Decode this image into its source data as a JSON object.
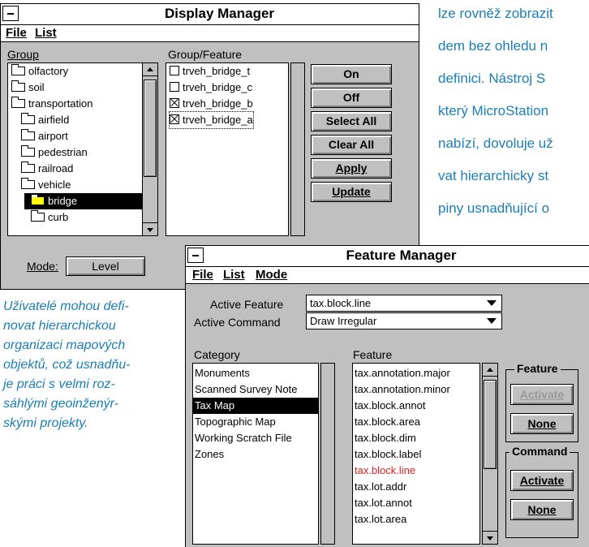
{
  "article": {
    "lines": [
      "lze rovněž zobrazit",
      "dem bez ohledu n",
      "definici. Nástroj S",
      "který MicroStation",
      "nabízí, dovoluje už",
      "vat hierarchicky st",
      "piny usnadňující o"
    ],
    "caption": [
      "Uživatelé mohou defi-",
      "novat hierarchickou",
      "organizaci mapových",
      "objektů, což usnadňu-",
      "je práci s velmi roz-",
      "sáhlými geoinženýr-",
      "skými projekty."
    ]
  },
  "display_manager": {
    "title": "Display Manager",
    "menu": [
      "File",
      "List"
    ],
    "group_label": "Group",
    "feature_label": "Group/Feature",
    "groups": [
      {
        "label": "olfactory",
        "indent": 0
      },
      {
        "label": "soil",
        "indent": 0
      },
      {
        "label": "transportation",
        "indent": 0
      },
      {
        "label": "airfield",
        "indent": 1
      },
      {
        "label": "airport",
        "indent": 1
      },
      {
        "label": "pedestrian",
        "indent": 1
      },
      {
        "label": "railroad",
        "indent": 1
      },
      {
        "label": "vehicle",
        "indent": 1
      },
      {
        "label": "bridge",
        "indent": 2,
        "selected": true
      },
      {
        "label": "curb",
        "indent": 2
      }
    ],
    "features": [
      {
        "label": "trveh_bridge_t",
        "checked": false
      },
      {
        "label": "trveh_bridge_c",
        "checked": false
      },
      {
        "label": "trveh_bridge_b",
        "checked": true
      },
      {
        "label": "trveh_bridge_a",
        "checked": true
      }
    ],
    "buttons": [
      "On",
      "Off",
      "Select All",
      "Clear All",
      "Apply",
      "Update"
    ],
    "mode_label": "Mode:",
    "mode_value": "Level"
  },
  "feature_manager": {
    "title": "Feature Manager",
    "menu": [
      "File",
      "List",
      "Mode"
    ],
    "active_feature_label": "Active Feature",
    "active_feature_value": "tax.block.line",
    "active_command_label": "Active Command",
    "active_command_value": "Draw Irregular",
    "category_label": "Category",
    "feature_label": "Feature",
    "categories": [
      "Monuments",
      "Scanned Survey Note",
      "Tax Map",
      "Topographic Map",
      "Working Scratch File",
      "Zones"
    ],
    "selected_category": "Tax Map",
    "features": [
      "tax.annotation.major",
      "tax.annotation.minor",
      "tax.block.annot",
      "tax.block.area",
      "tax.block.dim",
      "tax.block.label",
      "tax.block.line",
      "tax.lot.addr",
      "tax.lot.annot",
      "tax.lot.area"
    ],
    "highlighted_feature": "tax.block.line",
    "highlight_color": "#e02020",
    "feature_group": {
      "label": "Feature",
      "activate": "Activate",
      "none": "None"
    },
    "command_group": {
      "label": "Command",
      "activate": "Activate",
      "none": "None"
    }
  }
}
